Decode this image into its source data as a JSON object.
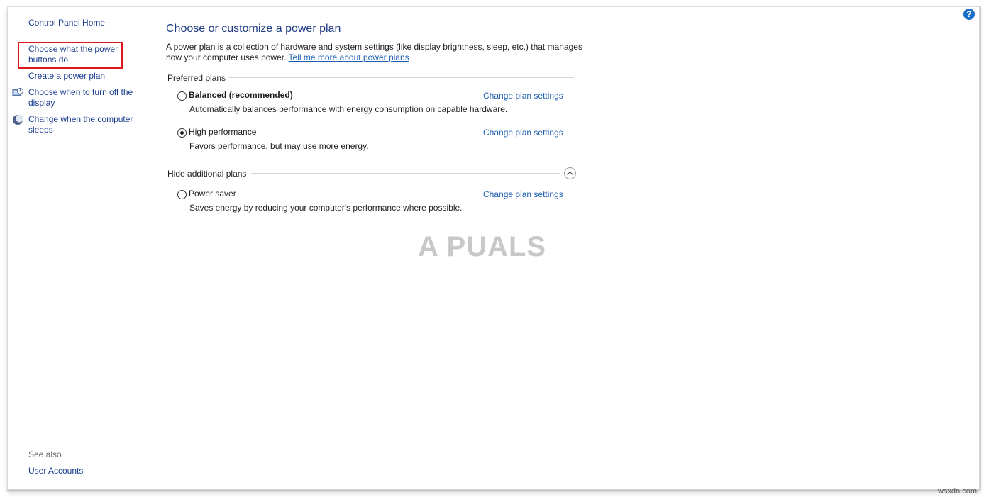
{
  "nav": {
    "home": "Control Panel Home",
    "items": [
      {
        "label": "Choose what the power buttons do",
        "icon": "none",
        "highlighted": true
      },
      {
        "label": "Create a power plan",
        "icon": "none"
      },
      {
        "label": "Choose when to turn off the display",
        "icon": "display-timer-icon"
      },
      {
        "label": "Change when the computer sleeps",
        "icon": "sleep-moon-icon"
      }
    ],
    "see_also": {
      "heading": "See also",
      "links": [
        {
          "label": "User Accounts"
        }
      ]
    }
  },
  "main": {
    "title": "Choose or customize a power plan",
    "intro": "A power plan is a collection of hardware and system settings (like display brightness, sleep, etc.) that manages how your computer uses power.",
    "intro_link": "Tell me more about power plans",
    "preferred": {
      "heading": "Preferred plans",
      "plans": [
        {
          "name": "Balanced (recommended)",
          "desc": "Automatically balances performance with energy consumption on capable hardware.",
          "selected": false,
          "link": "Change plan settings"
        },
        {
          "name": "High performance",
          "desc": "Favors performance, but may use more energy.",
          "selected": true,
          "link": "Change plan settings"
        }
      ]
    },
    "additional": {
      "heading": "Hide additional plans",
      "plans": [
        {
          "name": "Power saver",
          "desc": "Saves energy by reducing your computer's performance where possible.",
          "selected": false,
          "link": "Change plan settings"
        }
      ]
    }
  },
  "help": "?",
  "watermark": "A PUALS",
  "site": "wsxdn.com",
  "colors": {
    "link": "#1f5fb2",
    "nav_link": "#1a3d8f",
    "title": "#1e3b84",
    "highlight": "#e0161c",
    "help": "#1a6fc9"
  }
}
